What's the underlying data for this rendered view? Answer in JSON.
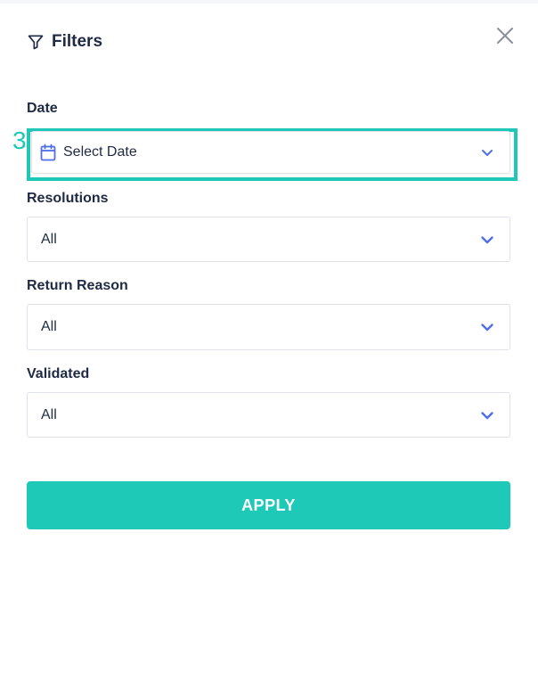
{
  "header": {
    "title": "Filters"
  },
  "marker": {
    "number": "3"
  },
  "fields": {
    "date": {
      "label": "Date",
      "value": "Select Date"
    },
    "resolutions": {
      "label": "Resolutions",
      "value": "All"
    },
    "return_reason": {
      "label": "Return Reason",
      "value": "All"
    },
    "validated": {
      "label": "Validated",
      "value": "All"
    }
  },
  "actions": {
    "apply_label": "APPLY"
  },
  "colors": {
    "accent": "#1fc9b8",
    "chevron": "#4f6ee8",
    "text": "#1f2a44",
    "border": "#dfe2e8"
  },
  "icons": {
    "filter": "filter-icon",
    "close": "close-icon",
    "calendar": "calendar-icon",
    "chevron": "chevron-down-icon"
  }
}
